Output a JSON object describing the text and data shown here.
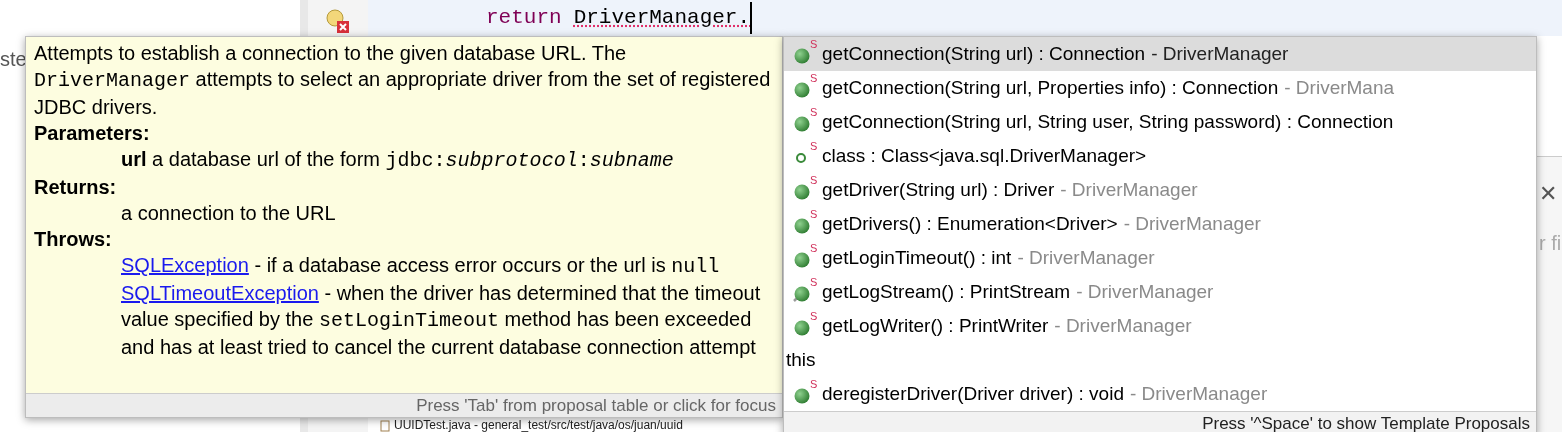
{
  "background": {
    "sidebar_fragment": "ste",
    "close_glyph": "✕",
    "right_fragment": "r fi",
    "file_row": "UUIDTest.java - general_test/src/test/java/os/juan/uuid"
  },
  "editor": {
    "line": [
      {
        "text": "return",
        "kind": "keyword"
      },
      {
        "text": "DriverManager.",
        "kind": "error"
      }
    ]
  },
  "javadoc": {
    "blocks": [
      {
        "kind": "text",
        "segments": [
          {
            "kind": "text",
            "text": "Attempts to establish a connection to the given database URL. The "
          },
          {
            "kind": "code",
            "text": "DriverManager"
          },
          {
            "kind": "text",
            "text": " attempts to select an appropriate driver from the set of registered JDBC drivers."
          }
        ]
      },
      {
        "kind": "heading",
        "segments": [
          {
            "kind": "text",
            "text": "Parameters:"
          }
        ]
      },
      {
        "kind": "entry",
        "segments": [
          {
            "kind": "bold",
            "text": "url"
          },
          {
            "kind": "text",
            "text": " a database url of the form "
          },
          {
            "kind": "code",
            "text": "jdbc:"
          },
          {
            "kind": "code_italic",
            "text": "subprotocol"
          },
          {
            "kind": "code",
            "text": ":"
          },
          {
            "kind": "code_italic",
            "text": "subname"
          }
        ]
      },
      {
        "kind": "heading",
        "segments": [
          {
            "kind": "text",
            "text": "Returns:"
          }
        ]
      },
      {
        "kind": "entry",
        "segments": [
          {
            "kind": "text",
            "text": "a connection to the URL"
          }
        ]
      },
      {
        "kind": "heading",
        "segments": [
          {
            "kind": "text",
            "text": "Throws:"
          }
        ]
      },
      {
        "kind": "entry",
        "segments": [
          {
            "kind": "link",
            "text": "SQLException"
          },
          {
            "kind": "text",
            "text": " - if a database access error occurs or the url is "
          },
          {
            "kind": "code",
            "text": "null"
          }
        ]
      },
      {
        "kind": "entry",
        "segments": [
          {
            "kind": "link",
            "text": "SQLTimeoutException"
          },
          {
            "kind": "text",
            "text": " - when the driver has determined that the timeout value specified by the "
          },
          {
            "kind": "code",
            "text": "setLoginTimeout"
          },
          {
            "kind": "text",
            "text": " method has been exceeded and has at least tried to cancel the current database connection attempt"
          }
        ]
      }
    ],
    "footer": "Press 'Tab' from proposal table or click for focus"
  },
  "proposals": {
    "items": [
      {
        "kind": "method",
        "modifier": "S",
        "deprecated": false,
        "selected": true,
        "text": "getConnection(String url) : Connection",
        "owner": "- DriverManager"
      },
      {
        "kind": "method",
        "modifier": "S",
        "deprecated": false,
        "selected": false,
        "text": "getConnection(String url, Properties info) : Connection",
        "owner": "- DriverMana"
      },
      {
        "kind": "method",
        "modifier": "S",
        "deprecated": false,
        "selected": false,
        "text": "getConnection(String url, String user, String password) : Connection"
      },
      {
        "kind": "field",
        "modifier": "S",
        "deprecated": false,
        "selected": false,
        "text": "class : Class<java.sql.DriverManager>"
      },
      {
        "kind": "method",
        "modifier": "S",
        "deprecated": false,
        "selected": false,
        "text": "getDriver(String url) : Driver",
        "owner": "- DriverManager"
      },
      {
        "kind": "method",
        "modifier": "S",
        "deprecated": false,
        "selected": false,
        "text": "getDrivers() : Enumeration<Driver>",
        "owner": "- DriverManager"
      },
      {
        "kind": "method",
        "modifier": "S",
        "deprecated": false,
        "selected": false,
        "text": "getLoginTimeout() : int",
        "owner": "- DriverManager"
      },
      {
        "kind": "method",
        "modifier": "S",
        "deprecated": true,
        "selected": false,
        "text": "getLogStream() : PrintStream",
        "owner": "- DriverManager"
      },
      {
        "kind": "method",
        "modifier": "S",
        "deprecated": false,
        "selected": false,
        "text": "getLogWriter() : PrintWriter",
        "owner": "- DriverManager"
      },
      {
        "kind": "group",
        "text": "this"
      },
      {
        "kind": "method",
        "modifier": "S",
        "deprecated": false,
        "selected": false,
        "text": "deregisterDriver(Driver driver) : void",
        "owner": "- DriverManager"
      }
    ],
    "footer": "Press '^Space' to show Template Proposals"
  }
}
